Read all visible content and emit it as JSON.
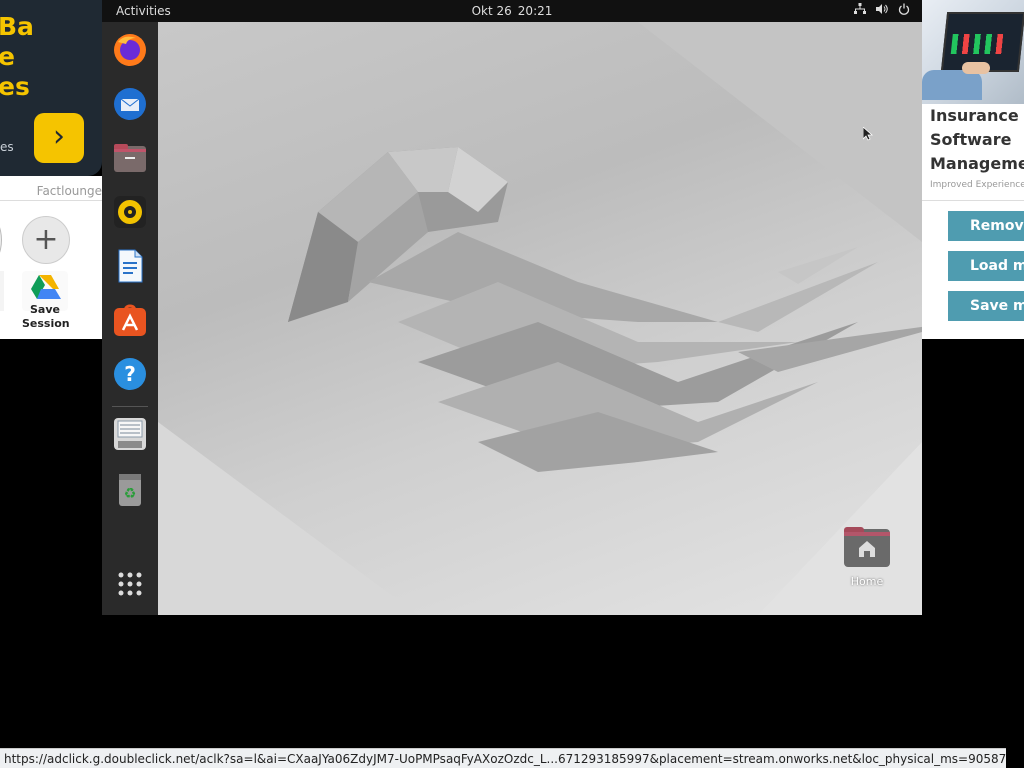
{
  "left_ad": {
    "headline_lines": [
      "Ba",
      "e",
      "es"
    ],
    "small_text": "es",
    "footer_text": "Factlounge"
  },
  "left_panel": {
    "save_session_label": "Save\nSession"
  },
  "right_ad": {
    "title_lines": [
      "Insurance",
      "Software",
      "Managemen"
    ],
    "subtitle": "Improved Experiences"
  },
  "right_panel": {
    "buttons": [
      "Remove",
      "Load my",
      "Save my"
    ]
  },
  "vm": {
    "topbar": {
      "activities": "Activities",
      "date": "Okt 26",
      "time": "20:21"
    },
    "dock": {
      "items": [
        "firefox-icon",
        "thunderbird-icon",
        "files-icon",
        "rhythmbox-icon",
        "libreoffice-writer-icon",
        "app-center-icon",
        "help-icon",
        "save-drive-icon",
        "trash-icon",
        "show-apps-icon"
      ]
    },
    "desktop": {
      "home_label": "Home"
    }
  },
  "statusbar": {
    "url": "https://adclick.g.doubleclick.net/aclk?sa=l&ai=CXaaJYa06ZdyJM7-UoPMPsaqFyAXozOzdc_L...671293185997&placement=stream.onworks.net&loc_physical_ms=9058761&loc_interest_ms="
  }
}
